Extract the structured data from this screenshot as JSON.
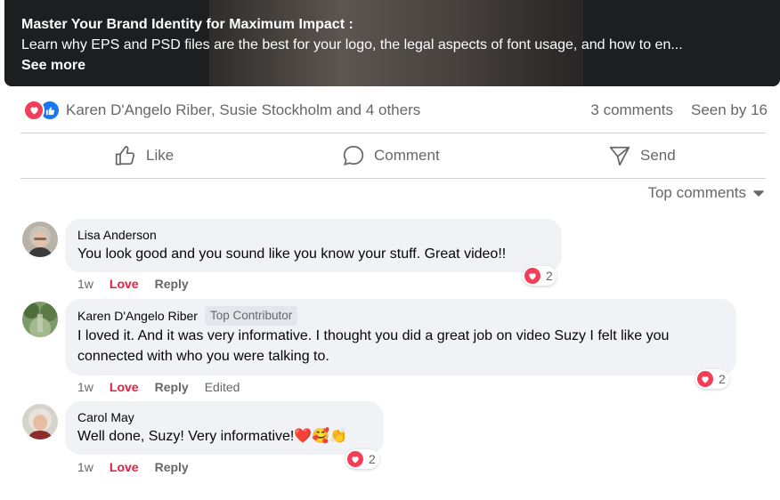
{
  "post": {
    "title": "Master Your Brand Identity for Maximum Impact :",
    "description": "Learn why EPS and PSD files are the best for your logo, the legal aspects of font usage, and how to en...",
    "see_more": "See more"
  },
  "reactions": {
    "names": "Karen D'Angelo Riber, Susie Stockholm and 4 others",
    "comments_count": "3 comments",
    "seen_by": "Seen by 16"
  },
  "actions": {
    "like": "Like",
    "comment": "Comment",
    "send": "Send"
  },
  "sort": {
    "label": "Top comments"
  },
  "comments": [
    {
      "name": "Lisa Anderson",
      "text": "You look good and you sound like you know your stuff. Great video!!",
      "time": "1w",
      "love": "Love",
      "reply": "Reply",
      "reaction_count": "2"
    },
    {
      "name": "Karen D'Angelo Riber",
      "badge": "Top Contributor",
      "text": "I loved it. And it was very informative. I thought you did a great job on video Suzy I felt like you connected with who you were talking to.",
      "time": "1w",
      "love": "Love",
      "reply": "Reply",
      "edited": "Edited",
      "reaction_count": "2"
    },
    {
      "name": "Carol May",
      "text": "Well done, Suzy! Very informative!❤️🥰👏",
      "time": "1w",
      "love": "Love",
      "reply": "Reply",
      "reaction_count": "2"
    }
  ],
  "colors": {
    "love": "#f33e58",
    "like": "#1877f2",
    "secondary_text": "#65676b",
    "bubble": "#f0f2f5"
  }
}
